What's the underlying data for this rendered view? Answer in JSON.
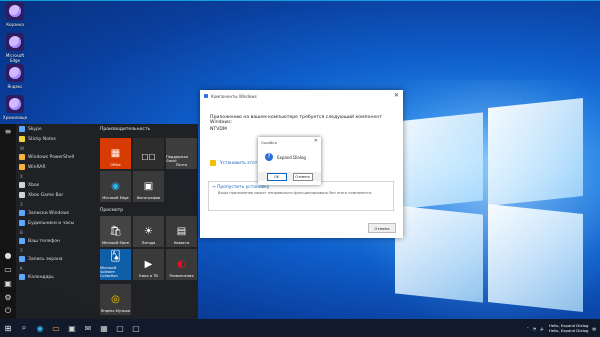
{
  "desktop": {
    "icons": [
      {
        "label": "Корзина"
      },
      {
        "label": "Microsoft Edge"
      },
      {
        "label": "Яндекс"
      },
      {
        "label": "Хранилище"
      }
    ]
  },
  "start_menu": {
    "applist": [
      {
        "kind": "item",
        "label": "Skype"
      },
      {
        "kind": "item",
        "label": "Sticky Notes"
      },
      {
        "kind": "letter",
        "label": "W"
      },
      {
        "kind": "item",
        "label": "Windows PowerShell"
      },
      {
        "kind": "item",
        "label": "WinRAR"
      },
      {
        "kind": "letter",
        "label": "X"
      },
      {
        "kind": "item",
        "label": "Xbox"
      },
      {
        "kind": "item",
        "label": "Xbox Game Bar"
      },
      {
        "kind": "letter",
        "label": "З"
      },
      {
        "kind": "item",
        "label": "Записки Windows"
      },
      {
        "kind": "item",
        "label": "Будильники и часы"
      },
      {
        "kind": "letter",
        "label": "В"
      },
      {
        "kind": "item",
        "label": "Ваш телефон"
      },
      {
        "kind": "letter",
        "label": "З"
      },
      {
        "kind": "item",
        "label": "Запись экрана"
      },
      {
        "kind": "letter",
        "label": "К"
      },
      {
        "kind": "item",
        "label": "Календарь"
      }
    ],
    "tiles": {
      "section1": "Производительность",
      "section2": "Просмотр",
      "office": "Office",
      "mail_tile": "Поддержка Gmail",
      "mail": "Почта",
      "edge": "Microsoft Edge",
      "photos": "Фотографии",
      "store": "Microsoft Store",
      "weather": "Погода",
      "news": "Новости",
      "solitaire": "Microsoft Solitaire Collection",
      "films": "Кино и ТВ",
      "play": "Развлечения",
      "music": "Яндекс.Музыка"
    }
  },
  "components_dialog": {
    "title": "Компоненты Windows",
    "message": "Приложению на вашем компьютере требуется следующий компонент Windows:",
    "component": "NTVDM",
    "option1": "Установить этот компонент",
    "option2": "Пропустить установку",
    "option2_sub": "Ваше приложение может неправильно функционировать без этого компонента.",
    "cancel": "Отмена"
  },
  "message_box": {
    "title": "Ошибка",
    "text": "Expand Dialog",
    "ok": "OK",
    "cancel": "Отмена"
  },
  "taskbar": {
    "tray_text": "Hello, Expand Dialog",
    "tray_text2": "Hello, Expand Dialog"
  },
  "colors": {
    "accent": "#0a64c9",
    "office_tile": "#d83b01",
    "store_tile": "#444444"
  }
}
